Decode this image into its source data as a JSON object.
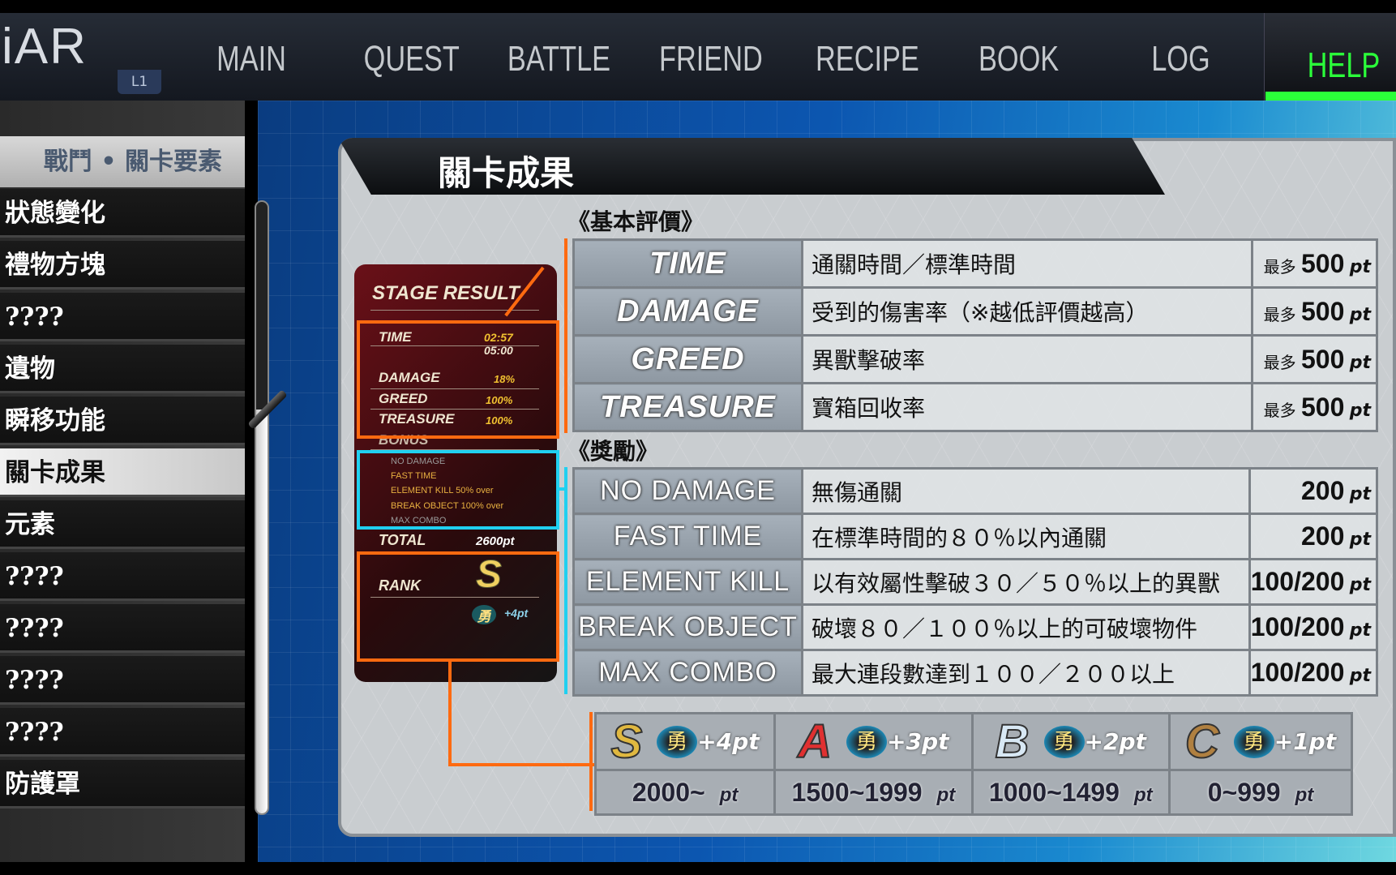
{
  "header": {
    "logo": "iAR",
    "badge": "L1",
    "nav": [
      "MAIN",
      "QUEST",
      "BATTLE",
      "FRIEND",
      "RECIPE",
      "BOOK",
      "LOG"
    ],
    "help": "HELP",
    "accent": "#2bff3a"
  },
  "sidebar": {
    "title": "戰鬥 • 關卡要素",
    "items": [
      "狀態變化",
      "禮物方塊",
      "????",
      "遺物",
      "瞬移功能",
      "關卡成果",
      "元素",
      "????",
      "????",
      "????",
      "????",
      "防護罩"
    ],
    "selected": "關卡成果"
  },
  "panel": {
    "title": "關卡成果",
    "card": {
      "title": "STAGE RESULT",
      "time_label": "TIME",
      "time": "02:57",
      "time_std": "05:00",
      "damage_label": "DAMAGE",
      "damage": "18%",
      "greed_label": "GREED",
      "greed": "100%",
      "treasure_label": "TREASURE",
      "treasure": "100%",
      "bonus_label": "BONUS",
      "bonus": [
        "NO DAMAGE",
        "FAST TIME",
        "ELEMENT KILL  50% over",
        "BREAK OBJECT 100% over",
        "MAX COMBO"
      ],
      "total_label": "TOTAL",
      "total": "2600pt",
      "rank_label": "RANK",
      "rank": "S",
      "brave": "勇",
      "brave_pt": "+4pt"
    },
    "basic": {
      "header": "《基本評價》",
      "rows": [
        {
          "label": "TIME",
          "desc": "通關時間／標準時間",
          "prefix": "最多",
          "value": "500",
          "unit": "pt"
        },
        {
          "label": "DAMAGE",
          "desc": "受到的傷害率（※越低評價越高）",
          "prefix": "最多",
          "value": "500",
          "unit": "pt"
        },
        {
          "label": "GREED",
          "desc": "異獸擊破率",
          "prefix": "最多",
          "value": "500",
          "unit": "pt"
        },
        {
          "label": "TREASURE",
          "desc": "寶箱回收率",
          "prefix": "最多",
          "value": "500",
          "unit": "pt"
        }
      ]
    },
    "bonus": {
      "header": "《獎勵》",
      "rows": [
        {
          "label": "NO DAMAGE",
          "desc": "無傷通關",
          "value": "200",
          "unit": "pt"
        },
        {
          "label": "FAST TIME",
          "desc": "在標準時間的８０％以內通關",
          "value": "200",
          "unit": "pt"
        },
        {
          "label": "ELEMENT KILL",
          "desc": "以有效屬性擊破３０／５０％以上的異獸",
          "value": "100/200",
          "unit": "pt"
        },
        {
          "label": "BREAK OBJECT",
          "desc": "破壞８０／１００％以上的可破壞物件",
          "value": "100/200",
          "unit": "pt"
        },
        {
          "label": "MAX COMBO",
          "desc": "最大連段數達到１００／２００以上",
          "value": "100/200",
          "unit": "pt"
        }
      ]
    },
    "ranks": [
      {
        "rank": "S",
        "brave": "勇",
        "bonus": "+4pt",
        "range": "2000~",
        "unit": "pt",
        "color": "#e0b840"
      },
      {
        "rank": "A",
        "brave": "勇",
        "bonus": "+3pt",
        "range": "1500~1999",
        "unit": "pt",
        "color": "#e03030"
      },
      {
        "rank": "B",
        "brave": "勇",
        "bonus": "+2pt",
        "range": "1000~1499",
        "unit": "pt",
        "color": "#d8e8f4"
      },
      {
        "rank": "C",
        "brave": "勇",
        "bonus": "+1pt",
        "range": "0~999",
        "unit": "pt",
        "color": "#b08040"
      }
    ]
  }
}
